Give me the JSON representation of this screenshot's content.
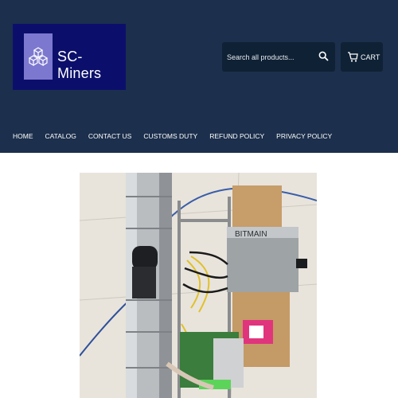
{
  "header": {
    "logo_text": "SC-Miners",
    "search_placeholder": "Search all products...",
    "cart_label": "CART"
  },
  "nav": {
    "items": [
      "HOME",
      "CATALOG",
      "CONTACT US",
      "CUSTOMS DUTY",
      "REFUND POLICY",
      "PRIVACY POLICY"
    ]
  },
  "product": {
    "image_brand_text": "BITMAIN"
  },
  "colors": {
    "header_bg": "#1c2f4c",
    "logo_bg": "#0b0f6b",
    "logo_mark": "#7d78cf"
  },
  "icons": {
    "logo": "cubes-icon",
    "search": "search-icon",
    "cart": "cart-icon"
  }
}
